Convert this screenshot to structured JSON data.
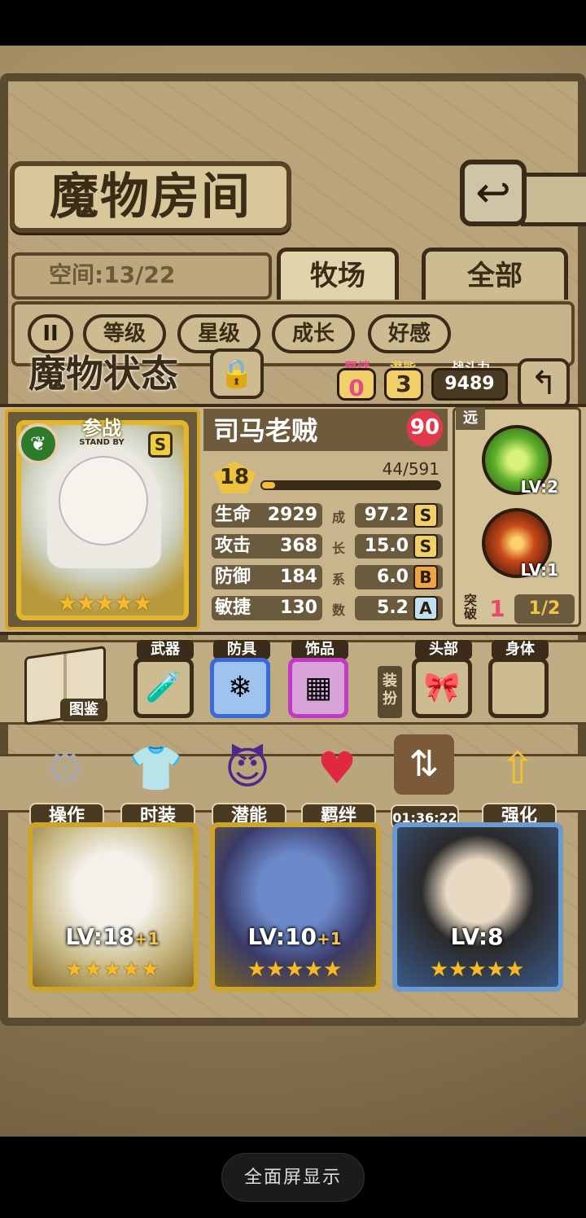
{
  "title": "魔物房间",
  "space": {
    "label": "空间:13/22"
  },
  "tabs": [
    {
      "label": "牧场"
    },
    {
      "label": "全部"
    }
  ],
  "sort_buttons": [
    "等级",
    "星级",
    "成长",
    "好感"
  ],
  "status": {
    "title": "魔物状态",
    "bond": {
      "label": "羁绊",
      "value": "0"
    },
    "potential": {
      "label": "潜能",
      "value": "3"
    },
    "power": {
      "label": "战斗力",
      "value": "9489"
    }
  },
  "monster": {
    "name": "司马老贼",
    "affection": "90",
    "standby": "参战",
    "standby_sub": "STAND BY",
    "grade": "S",
    "level": "18",
    "exp": "44/591",
    "exp_progress": 0.0745,
    "rarity_stars": 5,
    "stats": [
      {
        "name": "生命",
        "value": "2929",
        "growth": "97.2",
        "grade": "S"
      },
      {
        "name": "攻击",
        "value": "368",
        "growth": "15.0",
        "grade": "S"
      },
      {
        "name": "防御",
        "value": "184",
        "growth": "6.0",
        "grade": "B"
      },
      {
        "name": "敏捷",
        "value": "130",
        "growth": "5.2",
        "grade": "A"
      }
    ],
    "growth_label": [
      "成",
      "长",
      "系",
      "数"
    ]
  },
  "skills": {
    "range": "远",
    "list": [
      {
        "lv": "LV:2",
        "icon": "leaf-slash-icon"
      },
      {
        "lv": "LV:1",
        "icon": "fire-sword-icon"
      }
    ],
    "breakthrough_label": "突破",
    "breakthrough_value": "1",
    "breakthrough_fraction": "1/2"
  },
  "equipment": {
    "book_label": "图鉴",
    "dress_label": "装扮",
    "slots": [
      {
        "label": "武器",
        "icon": "potion-icon"
      },
      {
        "label": "防具",
        "icon": "crystal-icon"
      },
      {
        "label": "饰品",
        "icon": "rune-stone-icon"
      },
      {
        "label": "头部",
        "icon": "ribbon-icon"
      },
      {
        "label": "身体",
        "icon": ""
      }
    ]
  },
  "actions": [
    {
      "label": "操作",
      "icon": "gear-icon"
    },
    {
      "label": "时装",
      "icon": "outfit-icon"
    },
    {
      "label": "潜能",
      "icon": "demon-icon"
    },
    {
      "label": "羁绊",
      "icon": "hearts-icon"
    },
    {
      "label": "01:36:22",
      "icon": "swap-icon"
    },
    {
      "label": "强化",
      "icon": "upgrade-arrows-icon"
    }
  ],
  "monster_cards": [
    {
      "level": "LV:18",
      "bonus": "+1",
      "stars": 5
    },
    {
      "level": "LV:10",
      "bonus": "+1",
      "stars": 5
    },
    {
      "level": "LV:8",
      "bonus": "",
      "stars": 5
    }
  ],
  "fullscreen": "全面屏显示",
  "colors": {
    "gold": "#e2b72c",
    "panel": "#c9b58b",
    "dark": "#3a2c18"
  }
}
